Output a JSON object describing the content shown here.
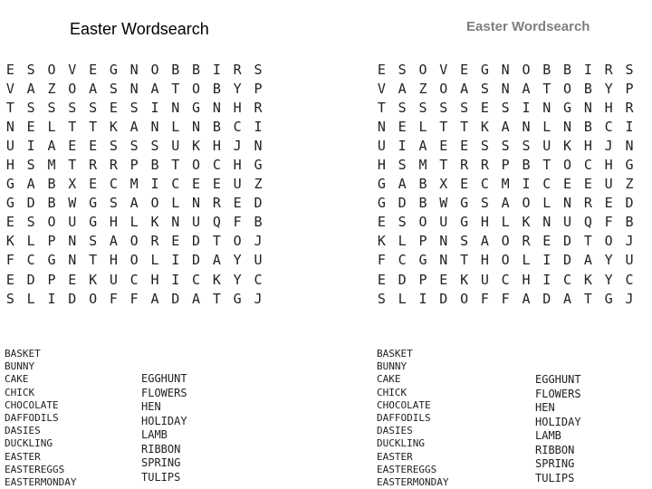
{
  "left": {
    "title": "Easter Wordsearch",
    "grid": [
      "ESOVEGNOBBIRS",
      "VAZOASNATOBYP",
      "TSSSSESINGNHR",
      "NELTTKANLNBCI",
      "UIAEESSSUKHJN",
      "HSMTRRPBTOCHG",
      "GABXECMICEEUZ",
      "GDBWGSAOLNRED",
      "ESOUGHLKNUQFB",
      "KLPNSAOREDTOJ",
      "FCGNTHOLIDAYU",
      "EDPEKUCHICKYC",
      "SLIDOFFADATGJ"
    ],
    "words_col1": [
      "BASKET",
      "BUNNY",
      "CAKE",
      "CHICK",
      "CHOCOLATE",
      "DAFFODILS",
      "DASIES",
      "DUCKLING",
      "EASTER",
      "EASTEREGGS",
      "EASTERMONDAY"
    ],
    "words_col2": [
      "EGGHUNT",
      "FLOWERS",
      "HEN",
      "HOLIDAY",
      "LAMB",
      "RIBBON",
      "SPRING",
      "TULIPS"
    ]
  },
  "right": {
    "title": "Easter Wordsearch",
    "grid": [
      "ESOVEGNOBBIRS",
      "VAZOASNATOBYP",
      "TSSSSESINGNHR",
      "NELTTKANLNBCI",
      "UIAEESSSUKHJN",
      "HSMTRRPBTOCHG",
      "GABXECMICEEUZ",
      "GDBWGSAOLNRED",
      "ESOUGHLKNUQFB",
      "KLPNSAOREDTOJ",
      "FCGNTHOLIDAYU",
      "EDPEKUCHICKYC",
      "SLIDOFFADATGJ"
    ],
    "words_col1": [
      "BASKET",
      "BUNNY",
      "CAKE",
      "CHICK",
      "CHOCOLATE",
      "DAFFODILS",
      "DASIES",
      "DUCKLING",
      "EASTER",
      "EASTEREGGS",
      "EASTERMONDAY"
    ],
    "words_col2": [
      "EGGHUNT",
      "FLOWERS",
      "HEN",
      "HOLIDAY",
      "LAMB",
      "RIBBON",
      "SPRING",
      "TULIPS"
    ]
  },
  "colors": {
    "title_left": "#000000",
    "title_right": "#7f7f7f",
    "text": "#222222",
    "background": "#ffffff"
  }
}
